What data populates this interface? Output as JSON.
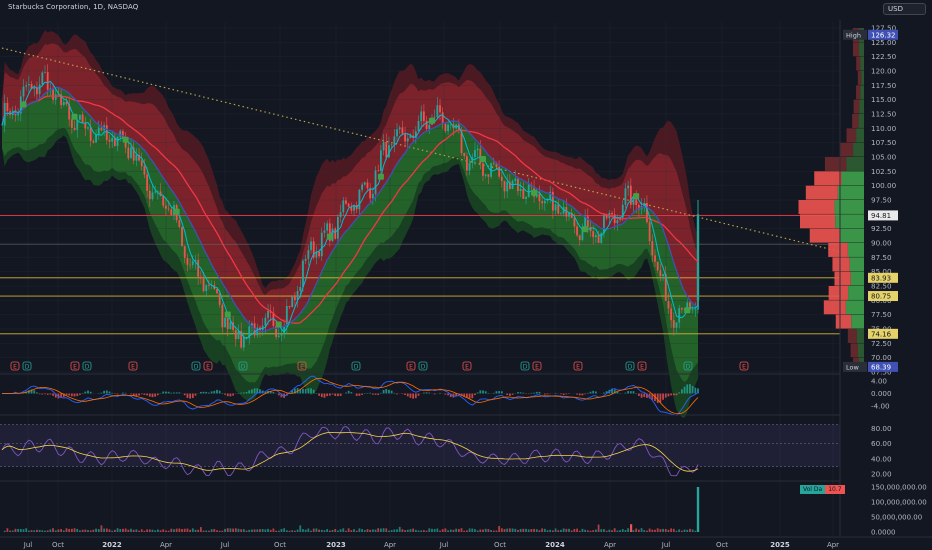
{
  "header": {
    "title": "Starbucks Corporation, 1D, NASDAQ",
    "currency": "USD"
  },
  "colors": {
    "background": "#131722",
    "up": "#26a69a",
    "down": "#ef5350",
    "ma_red": "#f23645",
    "ma_blue": "#3f51b5",
    "ma_teal": "#00bcd4",
    "band_red": "#7a1c22",
    "band_green": "#1b5e20",
    "horizontal_yellow": "#d4b23a",
    "horizontal_red": "#f23645",
    "trendline": "#b8a246",
    "rsi_line": "#7e57c2",
    "rsi_signal": "#f7d54a"
  },
  "chart_data": [
    {
      "type": "line",
      "panel": "price",
      "x_ticks": [
        "Jul",
        "Oct",
        "2022",
        "Apr",
        "Jul",
        "Oct",
        "2023",
        "Apr",
        "Jul",
        "Oct",
        "2024",
        "Apr",
        "Jul",
        "Oct",
        "2025",
        "Apr"
      ],
      "y_ticks": [
        "127.50",
        "125.00",
        "122.50",
        "120.00",
        "117.50",
        "115.00",
        "112.50",
        "110.00",
        "107.50",
        "105.00",
        "102.50",
        "100.00",
        "97.50",
        "95.00",
        "92.50",
        "90.00",
        "87.50",
        "85.00",
        "82.50",
        "80.00",
        "77.50",
        "75.00",
        "72.50",
        "70.00",
        "67.50"
      ],
      "ylim": [
        67.5,
        127.5
      ],
      "price_labels": {
        "high_label": "High",
        "high_value": "126.32",
        "low_label": "Low",
        "low_value": "68.39",
        "levels": [
          "94.81",
          "83.93",
          "80.75",
          "74.16"
        ]
      },
      "horizontal_lines": [
        {
          "value": 94.81,
          "color": "red"
        },
        {
          "value": 83.93,
          "color": "yellow"
        },
        {
          "value": 80.75,
          "color": "yellow"
        },
        {
          "value": 74.16,
          "color": "yellow"
        }
      ],
      "x": [
        0,
        5,
        10,
        15,
        20,
        25,
        30,
        35,
        40,
        45,
        50,
        55,
        60,
        65,
        70,
        75,
        80,
        85,
        88
      ],
      "series": [
        {
          "values": [
            112,
            118,
            110,
            108,
            98,
            84,
            74,
            76,
            90,
            98,
            108,
            112,
            104,
            100,
            96,
            92,
            98,
            78,
            79
          ]
        }
      ],
      "events": [
        "E",
        "D",
        "E",
        "D",
        "E",
        "D",
        "E",
        "D",
        "E",
        "D",
        "E",
        "D",
        "E",
        "D",
        "E"
      ]
    },
    {
      "type": "line",
      "panel": "macd",
      "y_ticks": [
        "4.00",
        "0.000",
        "-4.00"
      ],
      "ylim": [
        -6,
        6
      ]
    },
    {
      "type": "line",
      "panel": "rsi",
      "y_ticks": [
        "80.00",
        "60.00",
        "40.00",
        "20.00"
      ],
      "ylim": [
        15,
        95
      ]
    },
    {
      "type": "bar",
      "panel": "volume",
      "y_ticks": [
        "150,000,000.00",
        "100,000,000.00",
        "50,000,000.00",
        "0.0000"
      ],
      "ylim": [
        0,
        160000000
      ],
      "badge": [
        "Vol  Da",
        "10.7"
      ]
    }
  ]
}
